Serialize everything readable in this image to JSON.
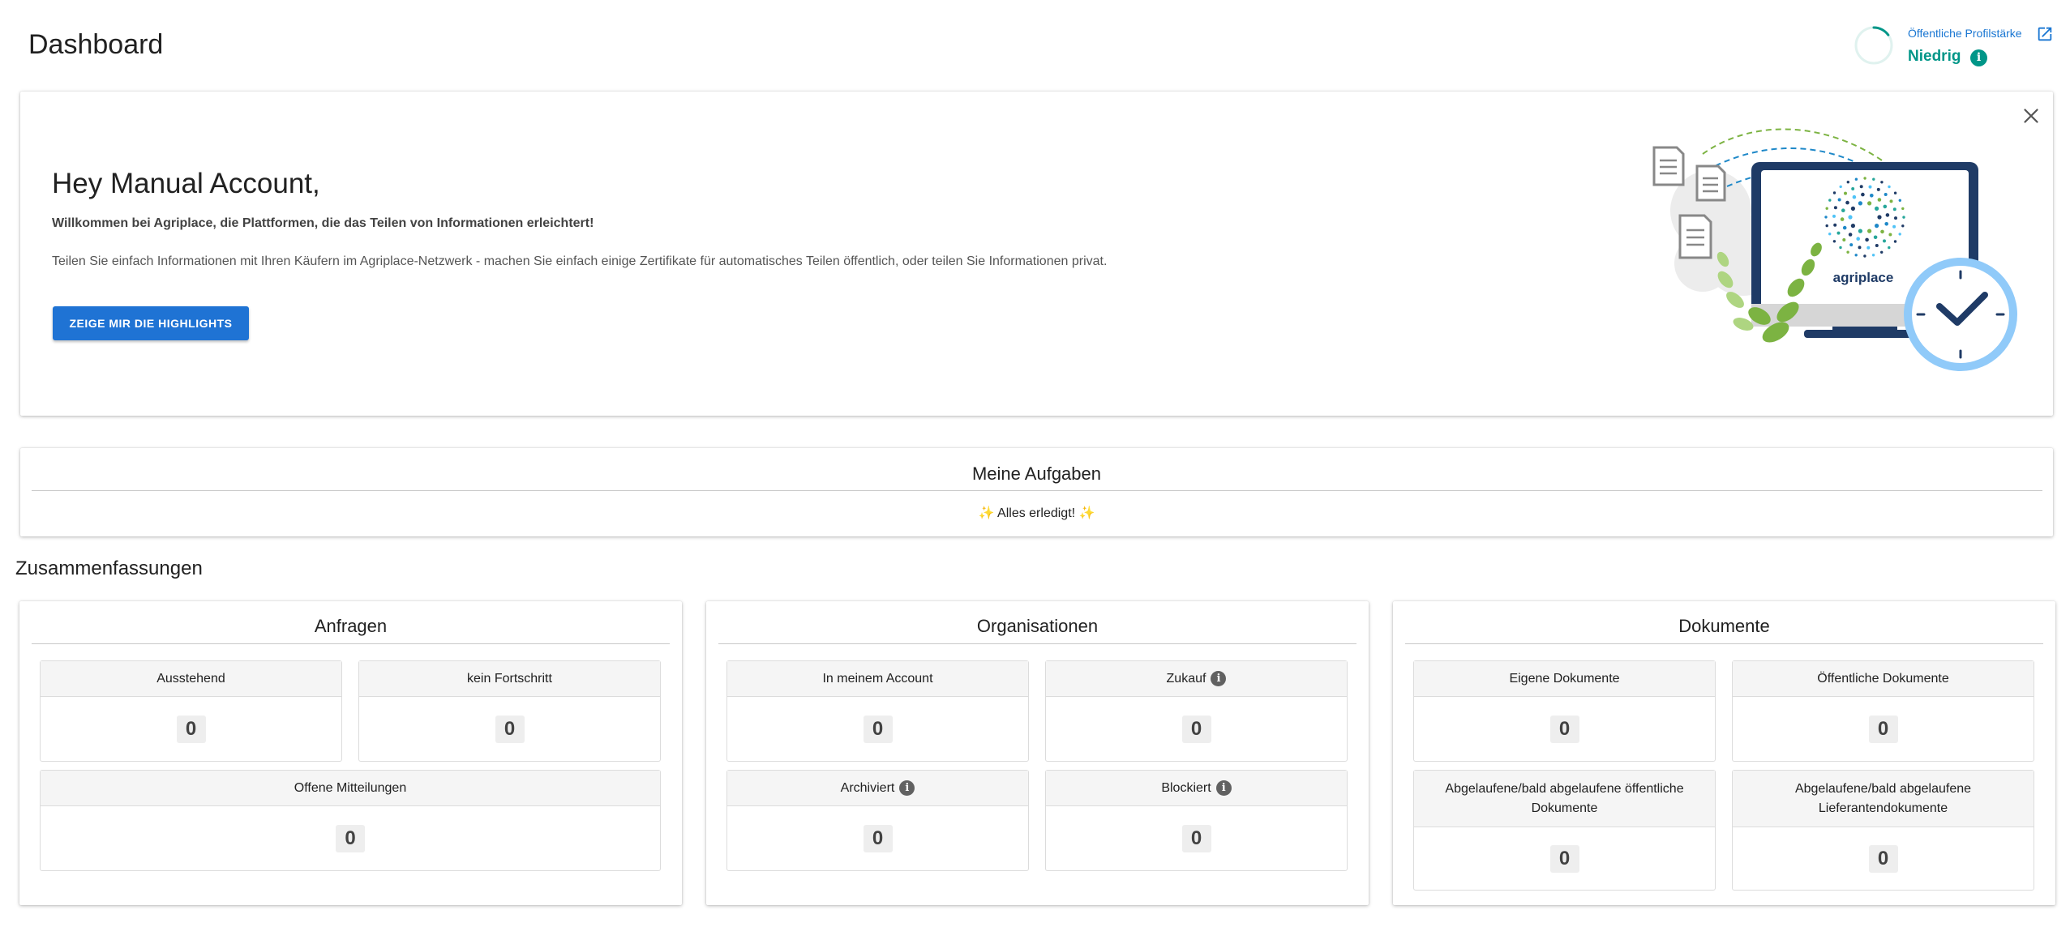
{
  "page": {
    "title": "Dashboard"
  },
  "profile_strength": {
    "label": "Öffentliche Profilstärke",
    "value": "Niedrig",
    "level_percent": 15,
    "accent_color": "#009688",
    "icon": "external-link-icon"
  },
  "welcome": {
    "greeting": "Hey Manual Account,",
    "intro": "Willkommen bei Agriplace, die Plattformen, die das Teilen von Informationen erleichtert!",
    "text": "Teilen Sie einfach Informationen mit Ihren Käufern im Agriplace-Netzwerk - machen Sie einfach einige Zertifikate für automatisches Teilen öffentlich, oder teilen Sie Informationen privat.",
    "button_label": "ZEIGE MIR DIE HIGHLIGHTS",
    "brand_logo_text": "agriplace"
  },
  "tasks": {
    "title": "Meine Aufgaben",
    "status": "✨ Alles erledigt! ✨"
  },
  "summaries": {
    "title": "Zusammenfassungen",
    "anfragen": {
      "title": "Anfragen",
      "tiles": [
        {
          "label": "Ausstehend",
          "value": "0"
        },
        {
          "label": "kein Fortschritt",
          "value": "0"
        },
        {
          "label": "Offene Mitteilungen",
          "value": "0"
        }
      ]
    },
    "organisationen": {
      "title": "Organisationen",
      "tiles": [
        {
          "label": "In meinem Account",
          "value": "0"
        },
        {
          "label": "Zukauf",
          "value": "0"
        },
        {
          "label": "Archiviert",
          "value": "0"
        },
        {
          "label": "Blockiert",
          "value": "0"
        }
      ]
    },
    "dokumente": {
      "title": "Dokumente",
      "tiles": [
        {
          "label": "Eigene Dokumente",
          "value": "0"
        },
        {
          "label": "Öffentliche Dokumente",
          "value": "0"
        },
        {
          "label": "Abgelaufene/bald abgelaufene öffentliche Dokumente",
          "value": "0"
        },
        {
          "label": "Abgelaufene/bald abgelaufene Lieferantendokumente",
          "value": "0"
        }
      ]
    }
  }
}
